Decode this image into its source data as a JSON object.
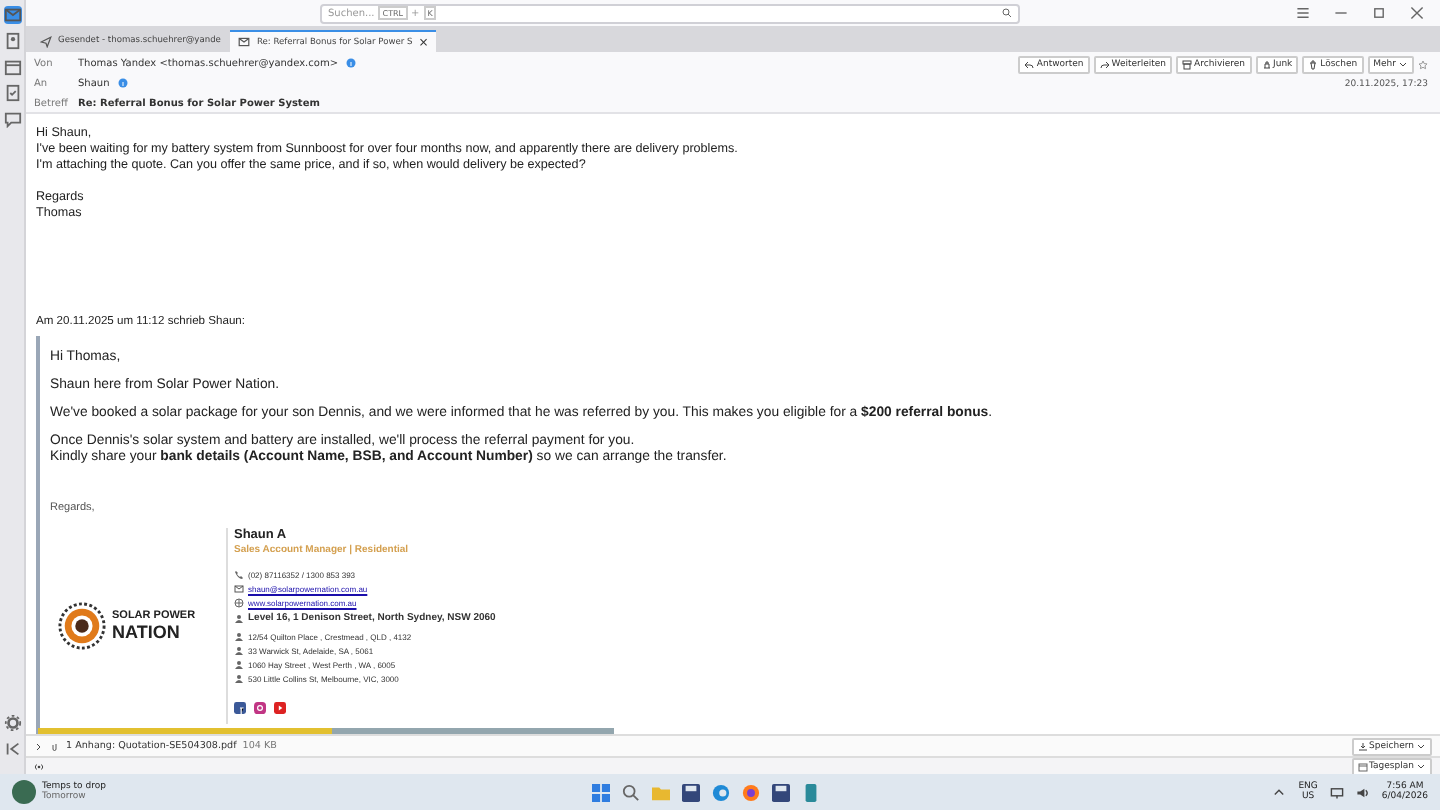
{
  "search": {
    "placeholder": "Suchen...",
    "shortcut": [
      "CTRL",
      "+",
      "K"
    ]
  },
  "tabs": [
    {
      "label": "Gesendet - thomas.schuehrer@yande",
      "selected": false
    },
    {
      "label": "Re: Referral Bonus for Solar Power S",
      "selected": true,
      "close": "×"
    }
  ],
  "header": {
    "fields": [
      {
        "label": "Von",
        "value": "Thomas Yandex <thomas.schuehrer@yandex.com>"
      },
      {
        "label": "An",
        "value": "Shaun"
      },
      {
        "label": "Betreff",
        "value": "Re: Referral Bonus for Solar Power System"
      }
    ],
    "buttons": [
      "Antworten",
      "Weiterleiten",
      "Archivieren",
      "Junk",
      "Löschen"
    ],
    "more": "Mehr",
    "date": "20.11.2025, 17:23"
  },
  "reply": [
    [
      "Hi Shaun,",
      "I've been waiting for my battery system from Sunnboost for over four months now, and apparently there are delivery problems.",
      "I'm attaching the quote. Can you offer the same price, and if so, when would delivery be expected?"
    ],
    [
      "Regards",
      "Thomas"
    ]
  ],
  "quote_header": "Am 20.11.2025 um 11:12 schrieb Shaun:",
  "quote": [
    "Hi Thomas,",
    "Shaun here from Solar Power Nation.",
    "We've booked a solar package for your son Dennis, and we were informed that he was referred by you. This makes you eligible for a **$200 referral bonus**.",
    "Once Dennis's solar system and battery are installed, we'll process the referral payment for you.\nKindly share your **bank details (Account Name, BSB, and Account Number)** so we can arrange the transfer."
  ],
  "closing": "Regards,",
  "signature": {
    "logo": [
      "SOLAR POWER",
      "NATION"
    ],
    "name": "Shaun A",
    "role": "Sales Account Manager | Residential",
    "lines": [
      {
        "kind": "phone",
        "text": "(02) 87116352 / 1300 853 393"
      },
      {
        "kind": "email",
        "text": "shaun@solarpowernation.com.au"
      },
      {
        "kind": "web",
        "text": "www.solarpowernation.com.au"
      },
      {
        "kind": "main",
        "text": "Level 16, 1 Denison Street, North Sydney, NSW 2060"
      },
      {
        "kind": "office",
        "text": "12/54 Quilton Place , Crestmead , QLD , 4132"
      },
      {
        "kind": "office",
        "text": "33 Warwick St, Adelaide, SA , 5061"
      },
      {
        "kind": "office",
        "text": "1060 Hay Street , West Perth , WA , 6005"
      },
      {
        "kind": "office",
        "text": "530 Little Collins St, Melbourne, VIC, 3000"
      }
    ]
  },
  "attachment": {
    "label": "1 Anhang: Quotation-SE504308.pdf",
    "size": "104 KB",
    "save": "Speichern"
  },
  "status_bar": {
    "agenda": "Tagesplan"
  },
  "taskbar": {
    "weather": [
      "Temps to drop",
      "Tomorrow"
    ],
    "lang": [
      "ENG",
      "US"
    ],
    "clock": [
      "7:56 AM",
      "6/04/2026"
    ]
  }
}
